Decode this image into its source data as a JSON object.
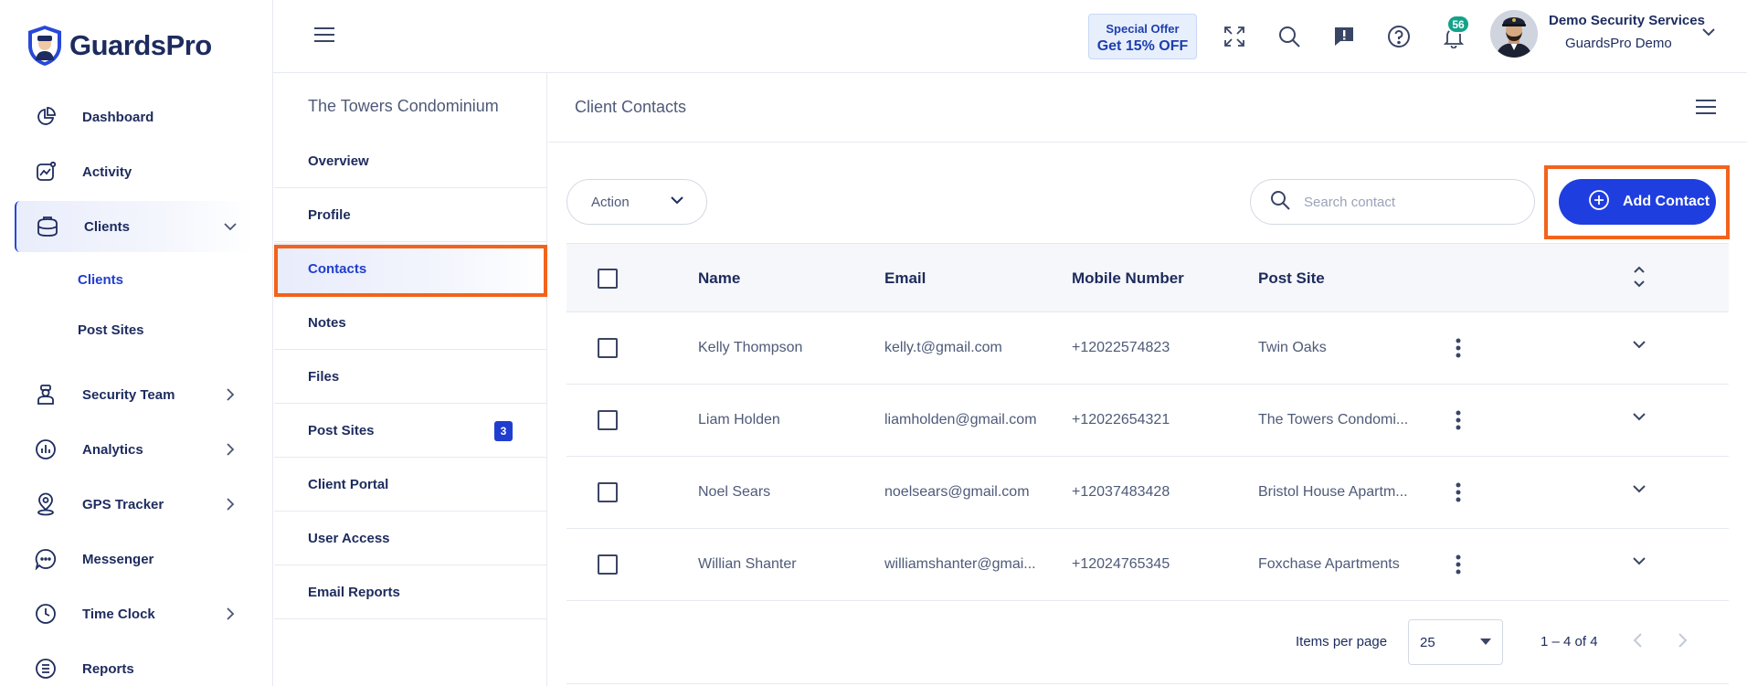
{
  "app": {
    "logo_text": "GuardsPro"
  },
  "sidebar": {
    "items": [
      {
        "label": "Dashboard",
        "icon": "pie-chart-icon"
      },
      {
        "label": "Activity",
        "icon": "activity-chart-icon"
      },
      {
        "label": "Clients",
        "icon": "briefcase-icon",
        "expanded": true
      },
      {
        "label": "Security Team",
        "icon": "guard-icon"
      },
      {
        "label": "Analytics",
        "icon": "bar-chart-icon"
      },
      {
        "label": "GPS Tracker",
        "icon": "map-pin-icon"
      },
      {
        "label": "Messenger",
        "icon": "chat-bubble-icon"
      },
      {
        "label": "Time Clock",
        "icon": "clock-icon"
      },
      {
        "label": "Reports",
        "icon": "report-list-icon"
      }
    ],
    "subitems": [
      {
        "label": "Clients",
        "active": true
      },
      {
        "label": "Post Sites"
      }
    ]
  },
  "topbar": {
    "offer_line1": "Special Offer",
    "offer_line2": "Get 15% OFF",
    "notification_count": "56",
    "user_name": "Demo Security Services",
    "user_org": "GuardsPro Demo"
  },
  "client_menu": {
    "title": "The Towers Condominium",
    "items": [
      {
        "label": "Overview"
      },
      {
        "label": "Profile"
      },
      {
        "label": "Contacts",
        "active": true
      },
      {
        "label": "Notes"
      },
      {
        "label": "Files"
      },
      {
        "label": "Post Sites",
        "badge": "3"
      },
      {
        "label": "Client Portal"
      },
      {
        "label": "User Access"
      },
      {
        "label": "Email Reports"
      }
    ]
  },
  "main": {
    "title": "Client Contacts",
    "action_label": "Action",
    "search_placeholder": "Search contact",
    "add_button_label": "Add Contact"
  },
  "table": {
    "columns": [
      "Name",
      "Email",
      "Mobile Number",
      "Post Site"
    ],
    "rows": [
      {
        "name": "Kelly Thompson",
        "email": "kelly.t@gmail.com",
        "mobile": "+12022574823",
        "site": "Twin Oaks"
      },
      {
        "name": "Liam Holden",
        "email": "liamholden@gmail.com",
        "mobile": "+12022654321",
        "site": "The Towers Condomi..."
      },
      {
        "name": "Noel Sears",
        "email": "noelsears@gmail.com",
        "mobile": "+12037483428",
        "site": "Bristol House Apartm..."
      },
      {
        "name": "Willian Shanter",
        "email": "williamshanter@gmai...",
        "mobile": "+12024765345",
        "site": "Foxchase Apartments"
      }
    ]
  },
  "pagination": {
    "items_per_page_label": "Items per page",
    "items_per_page_value": "25",
    "range": "1 – 4 of 4"
  },
  "colors": {
    "accent": "#1f3ee0",
    "highlight": "#f2631c",
    "badge_green": "#12a389"
  }
}
